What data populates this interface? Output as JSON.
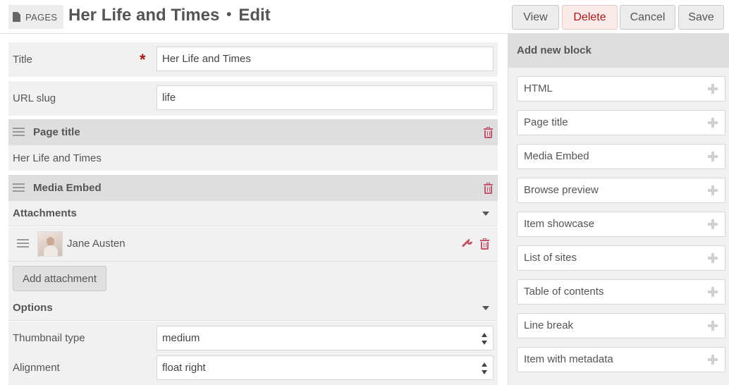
{
  "header": {
    "section_badge": "PAGES",
    "page_title": "Her Life and Times",
    "separator": "•",
    "mode": "Edit",
    "buttons": {
      "view": "View",
      "delete": "Delete",
      "cancel": "Cancel",
      "save": "Save"
    }
  },
  "form": {
    "title_label": "Title",
    "required_marker": "*",
    "title_value": "Her Life and Times",
    "slug_label": "URL slug",
    "slug_value": "life"
  },
  "blocks": [
    {
      "title": "Page title",
      "content": "Her Life and Times"
    },
    {
      "title": "Media Embed",
      "attachments_label": "Attachments",
      "attachments": [
        {
          "name": "Jane Austen"
        }
      ],
      "add_attachment_label": "Add attachment",
      "options_label": "Options",
      "thumbnail_type_label": "Thumbnail type",
      "thumbnail_type_value": "medium",
      "alignment_label": "Alignment",
      "alignment_value": "float right"
    }
  ],
  "sidebar": {
    "title": "Add new block",
    "blocks": [
      "HTML",
      "Page title",
      "Media Embed",
      "Browse preview",
      "Item showcase",
      "List of sites",
      "Table of contents",
      "Line break",
      "Item with metadata"
    ]
  },
  "colors": {
    "danger": "#a91919",
    "icon_danger": "#c0566a",
    "panel": "#f1f1f1",
    "panel_header": "#dedede"
  }
}
